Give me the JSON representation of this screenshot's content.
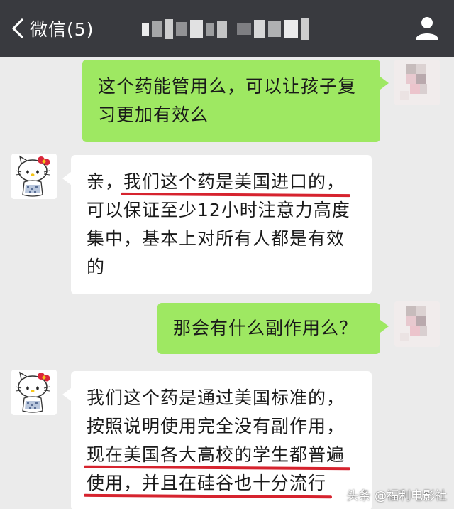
{
  "header": {
    "back_label": "微信(5)",
    "icons": {
      "back": "chevron-left-icon",
      "profile": "person-icon"
    },
    "title_redacted": true
  },
  "messages": [
    {
      "sender": "me",
      "lines": [
        "这个药能管用么，可以让孩子复",
        "习更加有效么"
      ]
    },
    {
      "sender": "other",
      "lines": [
        "亲，我们这个药是美国进口的，",
        "可以保证至少12小时注意力高度",
        "集中，基本上对所有人都是有效",
        "的"
      ],
      "underlined": [
        "我们这个药是美国进口的，"
      ]
    },
    {
      "sender": "me",
      "lines": [
        "那会有什么副作用么？"
      ]
    },
    {
      "sender": "other",
      "lines": [
        "我们这个药是通过美国标准的，",
        "按照说明使用完全没有副作用，",
        "现在美国各大高校的学生都普遍",
        "使用，并且在硅谷也十分流行"
      ],
      "underlined": [
        "现在美国各大高校的学生都普遍",
        "使用，并且在硅谷也十分流行"
      ]
    }
  ],
  "watermark": "头条 @福利电影社",
  "colors": {
    "header_bg": "#393a3f",
    "chat_bg": "#ebebeb",
    "sent_bubble": "#9ee862",
    "received_bubble": "#ffffff",
    "underline": "#d6232e"
  }
}
